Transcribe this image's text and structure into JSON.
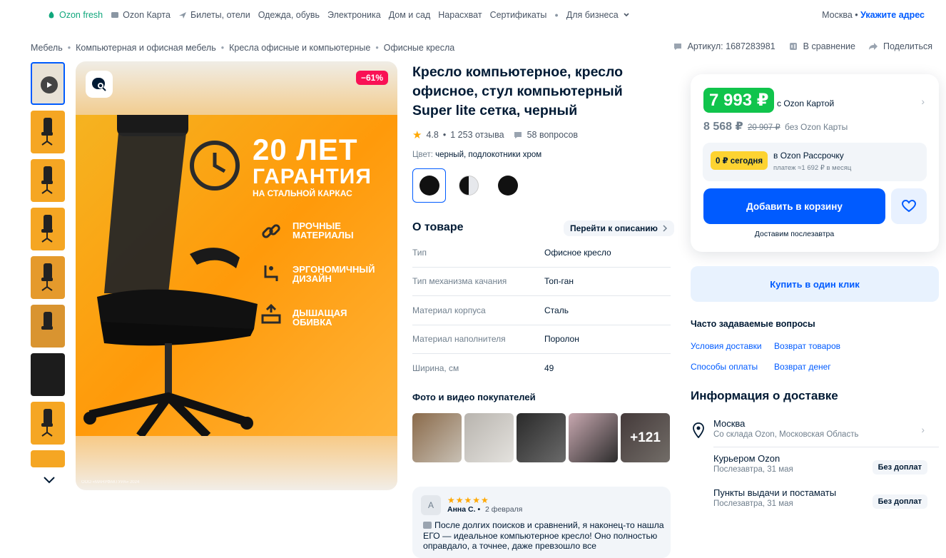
{
  "topnav": {
    "items": [
      {
        "label": "Ozon fresh",
        "icon": "ozon-fresh-icon",
        "color": "#10a77c"
      },
      {
        "label": "Ozon Карта",
        "icon": "card-icon"
      },
      {
        "label": "Билеты, отели",
        "icon": "plane-icon"
      },
      {
        "label": "Одежда, обувь"
      },
      {
        "label": "Электроника"
      },
      {
        "label": "Дом и сад"
      },
      {
        "label": "Нарасхват"
      },
      {
        "label": "Сертификаты"
      },
      {
        "label": "Для бизнеса",
        "icon": "chevron-down-icon"
      }
    ],
    "city": "Москва",
    "address_link": "Укажите адрес"
  },
  "breadcrumbs": [
    "Мебель",
    "Компьютерная и офисная мебель",
    "Кресла офисные и компьютерные",
    "Офисные кресла"
  ],
  "meta": {
    "sku": "Артикул: 1687283981",
    "compare": "В сравнение",
    "share": "Поделиться"
  },
  "gallery": {
    "discount": "−61%",
    "promo_title": "20 ЛЕТ",
    "promo_subtitle": "ГАРАНТИЯ",
    "promo_caption": "НА СТАЛЬНОЙ КАРКАС",
    "features": [
      "ПРОЧНЫЕ МАТЕРИАЛЫ",
      "ЭРГОНОМИЧНЫЙ ДИЗАЙН",
      "ДЫШАЩАЯ ОБИВКА"
    ],
    "copyright": "ООО «МАНУФАКТУРА» 2024"
  },
  "product": {
    "title": "Кресло компьютерное, кресло офисное, стул компьютерный Super lite сетка, черный",
    "rating": "4.8",
    "reviews": "1 253 отзыва",
    "questions": "58 вопросов",
    "color_label": "Цвет:",
    "color_value": "черный, подлокотники хром"
  },
  "about": {
    "heading": "О товаре",
    "link": "Перейти к описанию",
    "specs": [
      {
        "k": "Тип",
        "v": "Офисное кресло"
      },
      {
        "k": "Тип механизма качания",
        "v": "Топ-ган"
      },
      {
        "k": "Материал корпуса",
        "v": "Сталь"
      },
      {
        "k": "Материал наполнителя",
        "v": "Поролон"
      },
      {
        "k": "Ширина, см",
        "v": "49"
      }
    ]
  },
  "buyer_photos": {
    "heading": "Фото и видео покупателей",
    "more": "+121"
  },
  "review": {
    "avatar": "А",
    "stars": "★★★★★",
    "author": "Анна С.",
    "date": "2 февраля",
    "text": "После долгих поисков и сравнений, я наконец-то нашла ЕГО — идеальное компьютерное кресло! Оно полностью оправдало, а точнее, даже превзошло все"
  },
  "price": {
    "card_price": "7 993 ₽",
    "card_label": "с Ozon Картой",
    "regular_price": "8 568 ₽",
    "old_price": "20 907 ₽",
    "regular_label": "без Ozon Карты",
    "installment_pill": "0 ₽ сегодня",
    "installment_title": "в Ozon Рассрочку",
    "installment_sub": "платеж ≈1 692 ₽ в месяц",
    "cart_button": "Добавить в корзину",
    "delivery_note": "Доставим послезавтра",
    "one_click": "Купить в один клик"
  },
  "faq": {
    "heading": "Часто задаваемые вопросы",
    "links": [
      "Условия доставки",
      "Возврат товаров",
      "Способы оплаты",
      "Возврат денег"
    ]
  },
  "delivery": {
    "heading": "Информация о доставке",
    "rows": [
      {
        "a": "Москва",
        "b": "Со склада Ozon, Московская Область"
      },
      {
        "a": "Курьером Ozon",
        "b": "Послезавтра, 31 мая",
        "tag": "Без доплат"
      },
      {
        "a": "Пункты выдачи и постаматы",
        "b": "Послезавтра, 31 мая",
        "tag": "Без доплат"
      }
    ]
  },
  "colors": {
    "accent": "#005bff",
    "price_green": "#10c44c",
    "discount": "#f91155",
    "installment_yellow": "#fdd331"
  }
}
